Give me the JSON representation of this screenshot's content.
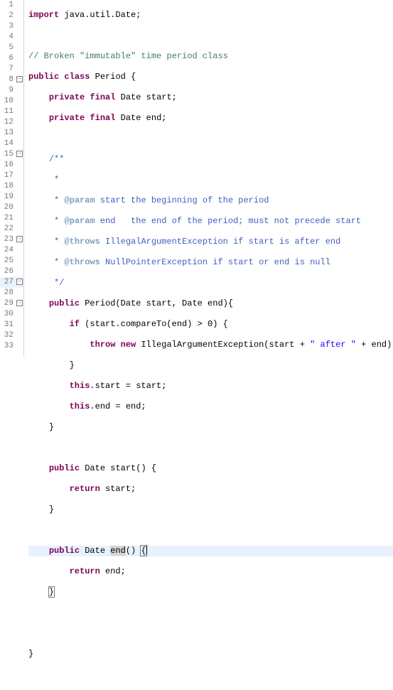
{
  "gutter": {
    "numbers": [
      "1",
      "2",
      "3",
      "4",
      "5",
      "6",
      "7",
      "8",
      "9",
      "10",
      "11",
      "12",
      "13",
      "14",
      "15",
      "16",
      "17",
      "18",
      "19",
      "20",
      "21",
      "22",
      "23",
      "24",
      "25",
      "26",
      "27",
      "28",
      "29",
      "30",
      "31",
      "32",
      "33"
    ],
    "fold_lines": [
      7,
      14,
      22,
      26,
      28
    ],
    "fold_glyph": "−"
  },
  "code": {
    "l1_kw": "import",
    "l1_rest": " java.util.Date;",
    "l3_comment": "// Broken \"immutable\" time period class",
    "l4_kw1": "public",
    "l4_kw2": "class",
    "l4_rest": " Period {",
    "l5_kw1": "private",
    "l5_kw2": "final",
    "l5_rest": " Date start;",
    "l6_kw1": "private",
    "l6_kw2": "final",
    "l6_rest": " Date end;",
    "l8_jd": "/**",
    "l9_jd": " *",
    "l10_jd_pre": " * ",
    "l10_tag": "@param",
    "l10_jd_post": " start the beginning of the period",
    "l11_jd_pre": " * ",
    "l11_tag": "@param",
    "l11_jd_post": " end   the end of the period; must not precede start",
    "l12_jd_pre": " * ",
    "l12_tag": "@throws",
    "l12_jd_post": " IllegalArgumentException if start is after end",
    "l13_jd_pre": " * ",
    "l13_tag": "@throws",
    "l13_jd_post": " NullPointerException if start or end is null",
    "l14_jd": " */",
    "l15_kw": "public",
    "l15_rest": " Period(Date start, Date end){",
    "l16_kw": "if",
    "l16_rest": " (start.compareTo(end) > 0) {",
    "l17_kw1": "throw",
    "l17_kw2": "new",
    "l17_mid": " IllegalArgumentException(start + ",
    "l17_str1": "\" after \"",
    "l17_mid2": " + end);",
    "l18": "}",
    "l19_kw": "this",
    "l19_rest": ".start = start;",
    "l20_kw": "this",
    "l20_rest": ".end = end;",
    "l21": "}",
    "l23_kw": "public",
    "l23_rest": " Date start() {",
    "l24_kw": "return",
    "l24_rest": " start;",
    "l25": "}",
    "l27_kw": "public",
    "l27_mid1": " Date ",
    "l27_sel": "end",
    "l27_mid2": "() ",
    "l27_brace": "{",
    "l28_kw": "return",
    "l28_rest": " end;",
    "l29": "}",
    "l32": "}"
  }
}
